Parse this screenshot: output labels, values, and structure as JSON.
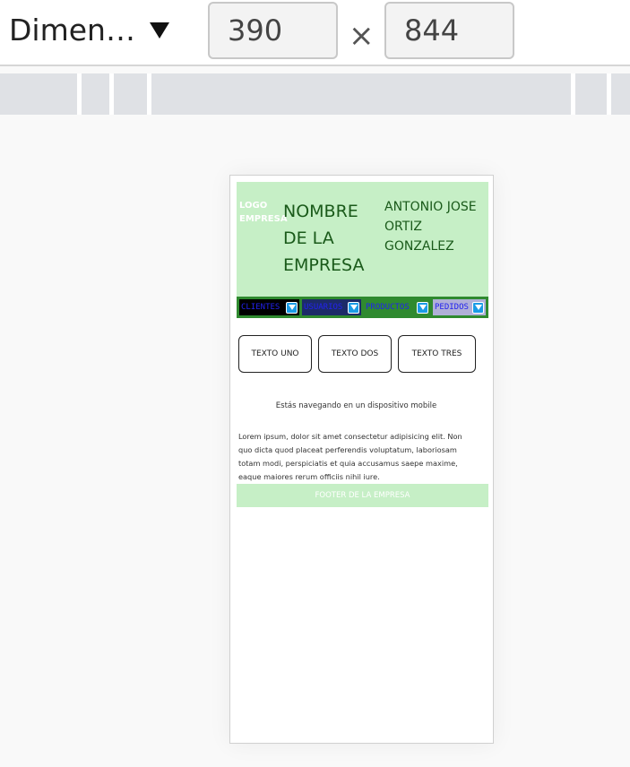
{
  "devtools": {
    "device_label": "Dimen…",
    "width_value": "390",
    "height_value": "844",
    "times_symbol": "×"
  },
  "site": {
    "logo": "LOGO EMPRESA",
    "company_name": "NOMBRE DE LA EMPRESA",
    "user_name": "ANTONIO JOSE ORTIZ GONZALEZ",
    "nav": [
      {
        "label": "CLIENTES"
      },
      {
        "label": "USUARIOS"
      },
      {
        "label": "PRODUCTOS"
      },
      {
        "label": "PEDIDOS"
      }
    ],
    "buttons": [
      {
        "label": "TEXTO UNO"
      },
      {
        "label": "TEXTO DOS"
      },
      {
        "label": "TEXTO TRES"
      }
    ],
    "notice": "Estás navegando en un dispositivo mobile",
    "body_text": "Lorem ipsum, dolor sit amet consectetur adipisicing elit. Non quo dicta quod placeat perferendis voluptatum, laboriosam totam modi, perspiciatis et quia accusamus saepe maxime, eaque maiores rerum officiis nihil iure.",
    "footer": "FOOTER DE LA EMPRESA"
  },
  "colors": {
    "header_bg": "#c6efc6",
    "nav_bg": "#2f8a2f",
    "dropdown_accent": "#1a9be6"
  }
}
